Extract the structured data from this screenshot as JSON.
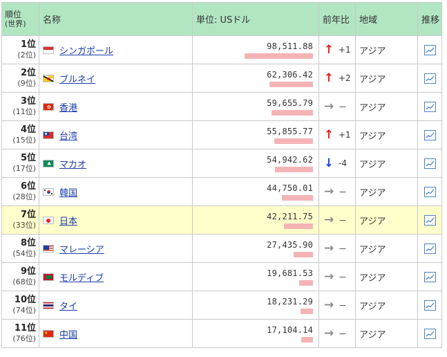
{
  "headers": {
    "rank": "順位",
    "rank_sub": "(世界)",
    "name": "名称",
    "unit": "単位: USドル",
    "change": "前年比",
    "region": "地域",
    "trend": "推移"
  },
  "colors": {
    "up": "#e8191f",
    "down": "#1f3fd6",
    "flat": "#888888",
    "bar": "#f4b4b6",
    "header": "#b2e6c3",
    "highlight": "#ffffcc"
  },
  "max_value": 98511.88,
  "rows": [
    {
      "rank": "1位",
      "world": "(2位)",
      "name": "シンガポール",
      "flag": "singapore-flag",
      "value": "98,511.88",
      "value_num": 98511.88,
      "dir": "up",
      "change": "+1",
      "region": "アジア",
      "highlight": false
    },
    {
      "rank": "2位",
      "world": "(9位)",
      "name": "ブルネイ",
      "flag": "brunei-flag",
      "value": "62,306.42",
      "value_num": 62306.42,
      "dir": "up",
      "change": "+2",
      "region": "アジア",
      "highlight": false
    },
    {
      "rank": "3位",
      "world": "(11位)",
      "name": "香港",
      "flag": "hongkong-flag",
      "value": "59,655.79",
      "value_num": 59655.79,
      "dir": "flat",
      "change": "－",
      "region": "アジア",
      "highlight": false
    },
    {
      "rank": "4位",
      "world": "(15位)",
      "name": "台湾",
      "flag": "taiwan-flag",
      "value": "55,855.77",
      "value_num": 55855.77,
      "dir": "up",
      "change": "+1",
      "region": "アジア",
      "highlight": false
    },
    {
      "rank": "5位",
      "world": "(17位)",
      "name": "マカオ",
      "flag": "macau-flag",
      "value": "54,942.62",
      "value_num": 54942.62,
      "dir": "down",
      "change": "-4",
      "region": "アジア",
      "highlight": false
    },
    {
      "rank": "6位",
      "world": "(28位)",
      "name": "韓国",
      "flag": "korea-flag",
      "value": "44,750.01",
      "value_num": 44750.01,
      "dir": "flat",
      "change": "－",
      "region": "アジア",
      "highlight": false
    },
    {
      "rank": "7位",
      "world": "(33位)",
      "name": "日本",
      "flag": "japan-flag",
      "value": "42,211.75",
      "value_num": 42211.75,
      "dir": "flat",
      "change": "－",
      "region": "アジア",
      "highlight": true
    },
    {
      "rank": "8位",
      "world": "(54位)",
      "name": "マレーシア",
      "flag": "malaysia-flag",
      "value": "27,435.90",
      "value_num": 27435.9,
      "dir": "flat",
      "change": "－",
      "region": "アジア",
      "highlight": false
    },
    {
      "rank": "9位",
      "world": "(68位)",
      "name": "モルディブ",
      "flag": "maldives-flag",
      "value": "19,681.53",
      "value_num": 19681.53,
      "dir": "flat",
      "change": "－",
      "region": "アジア",
      "highlight": false
    },
    {
      "rank": "10位",
      "world": "(74位)",
      "name": "タイ",
      "flag": "thailand-flag",
      "value": "18,231.29",
      "value_num": 18231.29,
      "dir": "flat",
      "change": "－",
      "region": "アジア",
      "highlight": false
    },
    {
      "rank": "11位",
      "world": "(76位)",
      "name": "中国",
      "flag": "china-flag",
      "value": "17,104.14",
      "value_num": 17104.14,
      "dir": "flat",
      "change": "－",
      "region": "アジア",
      "highlight": false
    }
  ]
}
